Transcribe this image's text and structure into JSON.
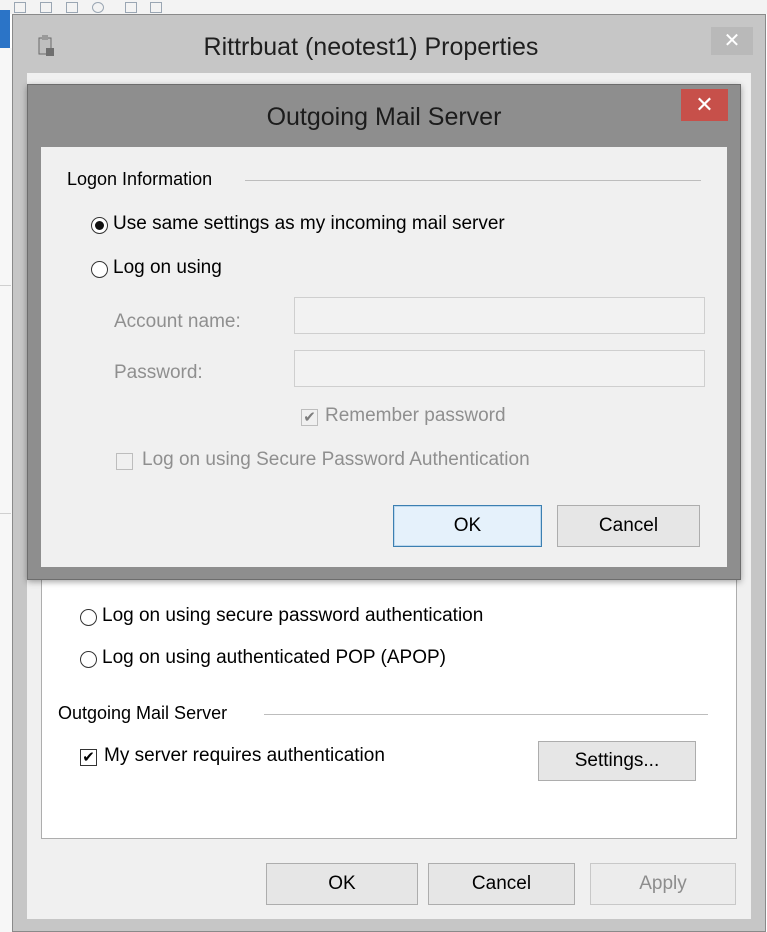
{
  "background": {
    "accent_color": "#2b74c7"
  },
  "properties_window": {
    "title": "Rittrbuat (neotest1) Properties",
    "close_glyph": "✕",
    "auth_options": [
      {
        "label": "Log on using secure password authentication",
        "selected": false
      },
      {
        "label": "Log on using authenticated POP (APOP)",
        "selected": false
      }
    ],
    "outgoing_group": {
      "title": "Outgoing Mail Server",
      "requires_auth_label": "My server requires authentication",
      "requires_auth_checked": true,
      "settings_button": "Settings..."
    },
    "buttons": {
      "ok": "OK",
      "cancel": "Cancel",
      "apply": "Apply"
    }
  },
  "outgoing_dialog": {
    "title": "Outgoing Mail Server",
    "close_glyph": "✕",
    "close_color": "#c7504a",
    "logon_group_title": "Logon Information",
    "options": {
      "same_settings_label": "Use same settings as my incoming mail server",
      "same_settings_selected": true,
      "log_on_using_label": "Log on using",
      "log_on_using_selected": false
    },
    "account_name_label": "Account name:",
    "account_name_value": "",
    "password_label": "Password:",
    "password_value": "",
    "remember_password_label": "Remember password",
    "remember_password_checked": true,
    "spa_label": "Log on using Secure Password Authentication",
    "spa_checked": false,
    "buttons": {
      "ok": "OK",
      "cancel": "Cancel"
    }
  }
}
